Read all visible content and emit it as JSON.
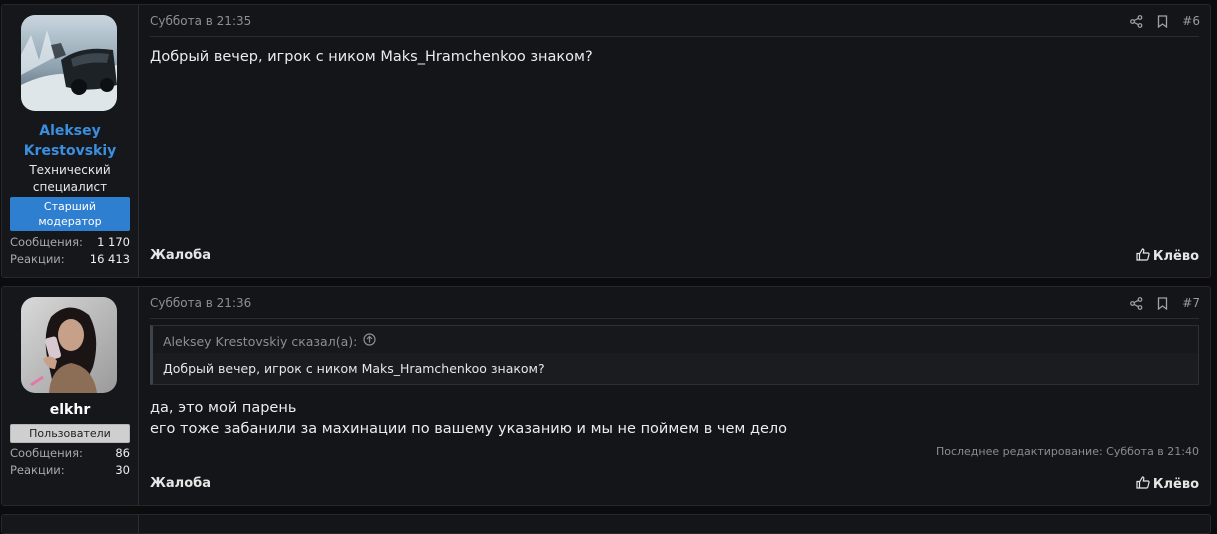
{
  "posts": [
    {
      "author": "Aleksey Krestovskiy",
      "title_line1": "Технический",
      "title_line2": "специалист",
      "banner_line1": "Старший",
      "banner_line2": "модератор",
      "stats": [
        {
          "label": "Сообщения:",
          "value": "1 170"
        },
        {
          "label": "Реакции:",
          "value": "16 413"
        }
      ],
      "date": "Суббота в 21:35",
      "number": "#6",
      "text": "Добрый вечер, игрок с ником Maks_Hramchenkoo знаком?",
      "report": "Жалоба",
      "like": "Клёво"
    },
    {
      "author": "elkhr",
      "banner": "Пользователи",
      "stats": [
        {
          "label": "Сообщения:",
          "value": "86"
        },
        {
          "label": "Реакции:",
          "value": "30"
        }
      ],
      "date": "Суббота в 21:36",
      "number": "#7",
      "quote_author": "Aleksey Krestovskiy сказал(а):",
      "quote_text": "Добрый вечер, игрок с ником Maks_Hramchenkoo знаком?",
      "text_line1": "да, это мой парень",
      "text_line2": "его тоже забанили за махинации по вашему указанию и мы не поймем в чем дело",
      "edited": "Последнее редактирование: Суббота в 21:40",
      "report": "Жалоба",
      "like": "Клёво"
    }
  ],
  "colors": {
    "background": "#0c0c0f",
    "post_bg": "#141519",
    "author_link": "#3b8fe0",
    "moderator_banner": "#2f7fd1",
    "user_banner": "#cfcfcf"
  },
  "icons": [
    "share-icon",
    "bookmark-icon",
    "thumbs-up-icon",
    "quote-jump-icon"
  ]
}
